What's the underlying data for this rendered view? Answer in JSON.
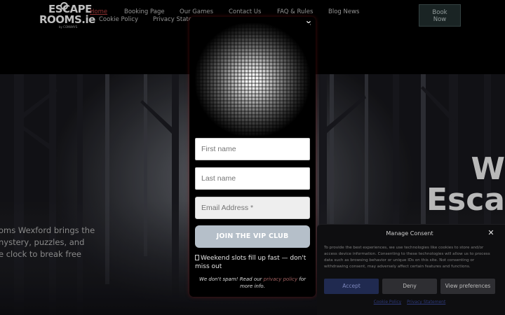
{
  "header": {
    "logo": {
      "line1": "ESCAPE",
      "line2": "ROOMS.ie",
      "line3": "by CONWAYS"
    },
    "nav": [
      {
        "label": "Home",
        "active": true
      },
      {
        "label": "Booking Page"
      },
      {
        "label": "Our Games"
      },
      {
        "label": "Contact Us"
      },
      {
        "label": "FAQ & Rules"
      },
      {
        "label": "Blog News"
      },
      {
        "label": "Cookie Policy"
      },
      {
        "label": "Privacy Stater"
      }
    ],
    "book_button": {
      "line1": "Book",
      "line2": "Now"
    }
  },
  "hero": {
    "title_line1": "W",
    "title_line2": "Esca",
    "text_lines": [
      "oms Wexford brings the",
      "nystery, puzzles, and",
      "e clock to break free"
    ]
  },
  "popup": {
    "close_label": "×",
    "first_name_placeholder": "First name",
    "last_name_placeholder": "Last name",
    "email_placeholder": "Email Address *",
    "join_label": "JOIN THE VIP CLUB",
    "weekend_note": "Weekend slots fill up fast — don't miss out",
    "spam_prefix": "We don't spam! Read our ",
    "spam_link": "privacy policy",
    "spam_suffix": " for more info."
  },
  "consent": {
    "title": "Manage Consent",
    "close_label": "✕",
    "body": "To provide the best experiences, we use technologies like cookies to store and/or access device information. Consenting to these technologies will allow us to process data such as browsing behavior or unique IDs on this site. Not consenting or withdrawing consent, may adversely affect certain features and functions.",
    "accept_label": "Accept",
    "deny_label": "Deny",
    "prefs_label": "View preferences",
    "links": [
      "Cookie Policy",
      "Privacy Statement"
    ]
  },
  "colors": {
    "accent_red": "#a63a3a",
    "join_button": "#b5bfc9",
    "accept_button": "#202a50"
  }
}
